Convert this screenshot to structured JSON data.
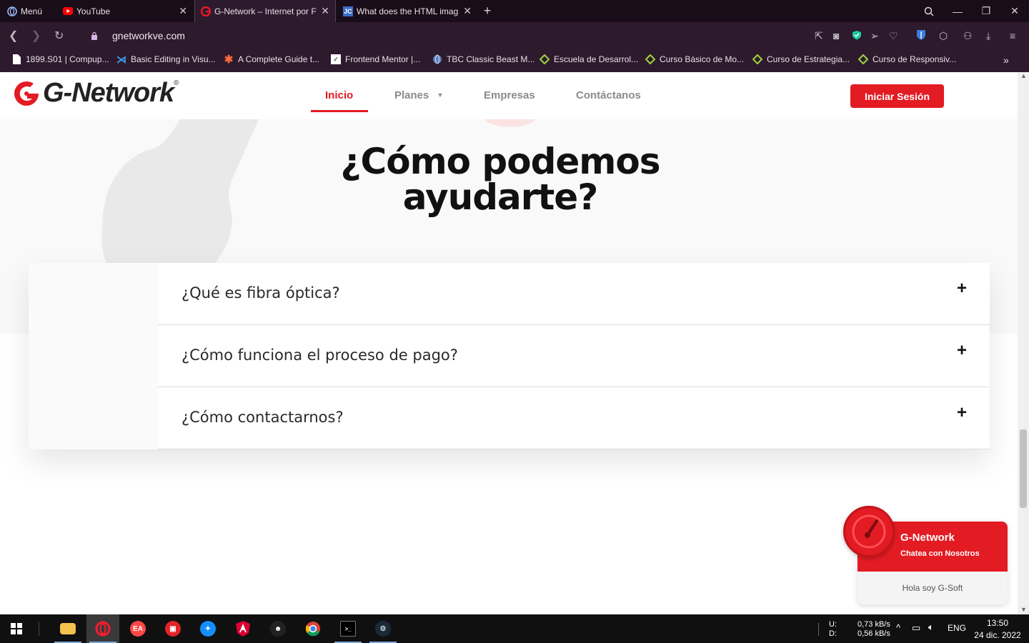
{
  "browser": {
    "menu_label": "Menú",
    "tabs": [
      {
        "title": "YouTube"
      },
      {
        "title": "G-Network – Internet por F"
      },
      {
        "title": "What does the HTML imag"
      }
    ],
    "url": "gnetworkve.com",
    "bookmarks": [
      {
        "label": "1899.S01 | Compup..."
      },
      {
        "label": "Basic Editing in Visu..."
      },
      {
        "label": "A Complete Guide t..."
      },
      {
        "label": "Frontend Mentor |..."
      },
      {
        "label": "TBC Classic Beast M..."
      },
      {
        "label": "Escuela de Desarrol..."
      },
      {
        "label": "Curso Básico de Mo..."
      },
      {
        "label": "Curso de Estrategia..."
      },
      {
        "label": "Curso de Responsiv..."
      }
    ]
  },
  "site": {
    "logo_text": "G-Network",
    "logo_reg": "®",
    "nav": [
      {
        "label": "Inicio"
      },
      {
        "label": "Planes"
      },
      {
        "label": "Empresas"
      },
      {
        "label": "Contáctanos"
      }
    ],
    "login_label": "Iniciar Sesión",
    "hero_title_line1": "¿Cómo podemos",
    "hero_title_line2": "ayudarte?",
    "faq": [
      {
        "question": "¿Qué es fibra óptica?",
        "toggle": "+"
      },
      {
        "question": "¿Cómo funciona el proceso de pago?",
        "toggle": "+"
      },
      {
        "question": "¿Cómo contactarnos?",
        "toggle": "+"
      }
    ],
    "chat": {
      "name": "G-Network",
      "subtitle": "Chatea con Nosotros",
      "message": "Hola soy G-Soft"
    }
  },
  "taskbar": {
    "net_up_label": "U:",
    "net_down_label": "D:",
    "net_up": "0,73 kB/s",
    "net_down": "0,56 kB/s",
    "language": "ENG",
    "time": "13:50",
    "date": "24 dic. 2022"
  },
  "colors": {
    "brand_red": "#e31b23",
    "browser_dark": "#1a0d1a",
    "browser_bar": "#2d1a2d"
  }
}
